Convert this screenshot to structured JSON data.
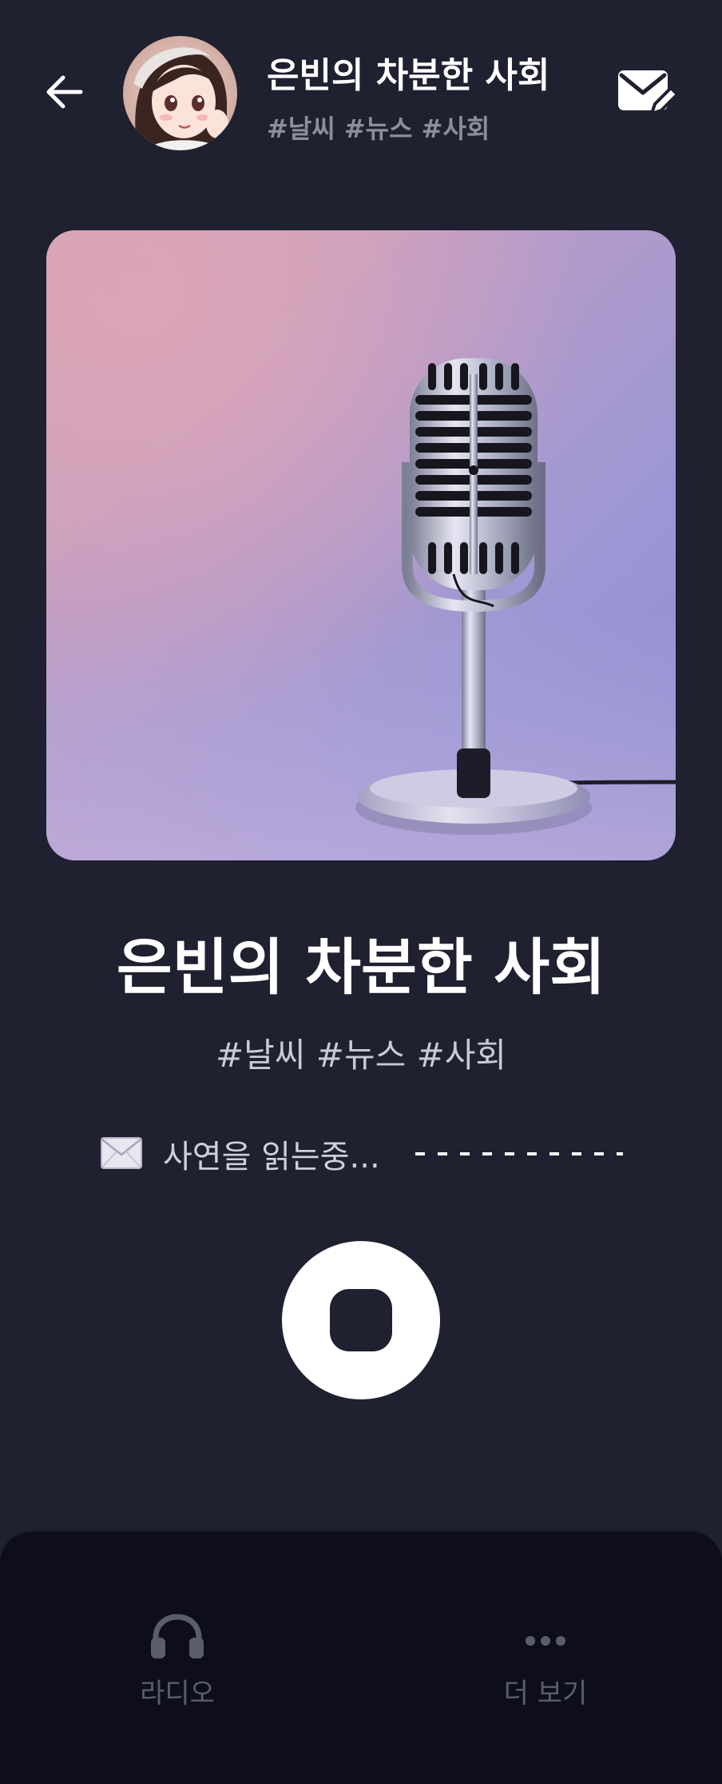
{
  "header": {
    "title": "은빈의 차분한 사회",
    "tags": "#날씨 #뉴스 #사회",
    "back_icon": "arrow-left-icon",
    "write_icon": "mail-edit-icon"
  },
  "cover": {
    "subject": "vintage microphone"
  },
  "main": {
    "title": "은빈의 차분한 사회",
    "tags": "#날씨 #뉴스 #사회"
  },
  "status": {
    "icon": "envelope-icon",
    "text": "사연을 읽는중..."
  },
  "controls": {
    "stop_icon": "stop-icon"
  },
  "bottom_nav": {
    "items": [
      {
        "label": "라디오",
        "icon": "headphones-icon"
      },
      {
        "label": "더 보기",
        "icon": "more-dots-icon"
      }
    ]
  },
  "colors": {
    "background": "#1f2030",
    "nav_background": "#0d0e1a",
    "text_primary": "#ffffff",
    "text_muted": "#8c8e98",
    "nav_inactive": "#5b5d6b"
  }
}
